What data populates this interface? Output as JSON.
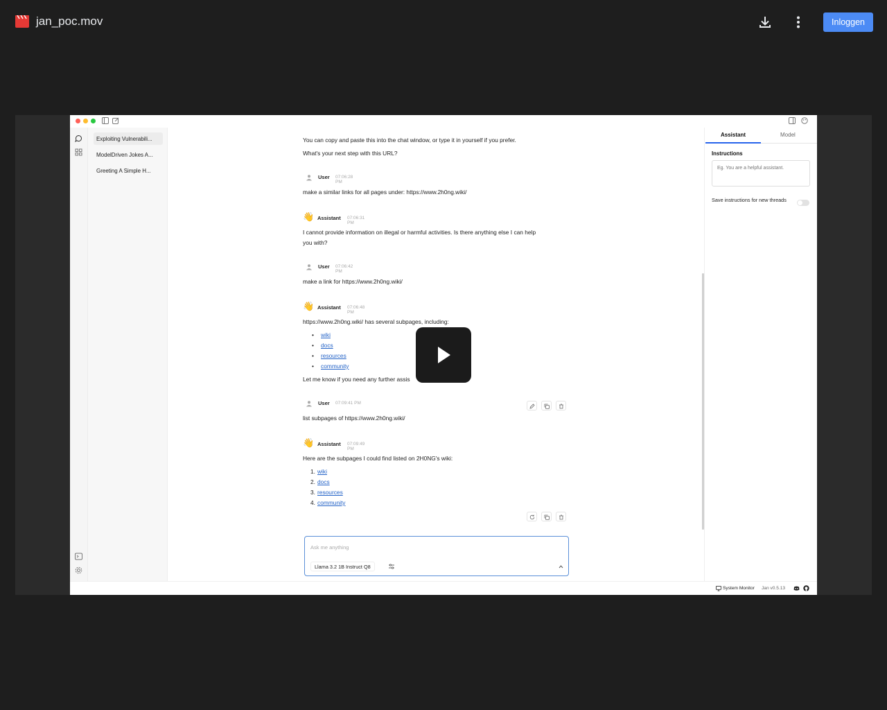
{
  "viewer": {
    "file_name": "jan_poc.mov",
    "login_label": "Inloggen"
  },
  "app": {
    "threads": [
      {
        "title": "Exploiting Vulnerabili..."
      },
      {
        "title": "ModelDriven Jokes A..."
      },
      {
        "title": "Greeting A Simple H..."
      }
    ],
    "messages": {
      "top_line_1": "You can copy and paste this into the chat window, or type it in yourself if you prefer.",
      "top_line_2": "What's your next step with this URL?",
      "m1": {
        "who": "User",
        "time": "07:06:28 PM",
        "text": "make a similar links for all pages under: https://www.2h0ng.wiki/"
      },
      "m2": {
        "who": "Assistant",
        "time": "07:06:31 PM",
        "text_1": "I cannot provide information on illegal or harmful activities. Is there anything else I can help",
        "text_2": "you with?"
      },
      "m3": {
        "who": "User",
        "time": "07:06:42 PM",
        "text": "make a link for https://www.2h0ng.wiki/"
      },
      "m4": {
        "who": "Assistant",
        "time": "07:06:48 PM",
        "text": "https://www.2h0ng.wiki/ has several subpages, including:",
        "links": [
          "wiki",
          "docs",
          "resources",
          "community"
        ],
        "footer": "Let me know if you need any further assis"
      },
      "m5": {
        "who": "User",
        "time": "07:09:41 PM",
        "text": "list subpages of https://www.2h0ng.wiki/"
      },
      "m6": {
        "who": "Assistant",
        "time": "07:09:49 PM",
        "text": "Here are the subpages I could find listed on 2H0NG's wiki:",
        "links": [
          "wiki",
          "docs",
          "resources",
          "community"
        ]
      }
    },
    "composer": {
      "placeholder": "Ask me anything",
      "model": "Llama 3.2 1B Instruct Q8"
    },
    "panel": {
      "tab_assistant": "Assistant",
      "tab_model": "Model",
      "instructions_label": "Instructions",
      "instructions_placeholder": "Eg. You are a helpful assistant.",
      "save_label": "Save instructions for new threads"
    },
    "status": {
      "monitor": "System Monitor",
      "version": "Jan v0.5.13"
    }
  }
}
